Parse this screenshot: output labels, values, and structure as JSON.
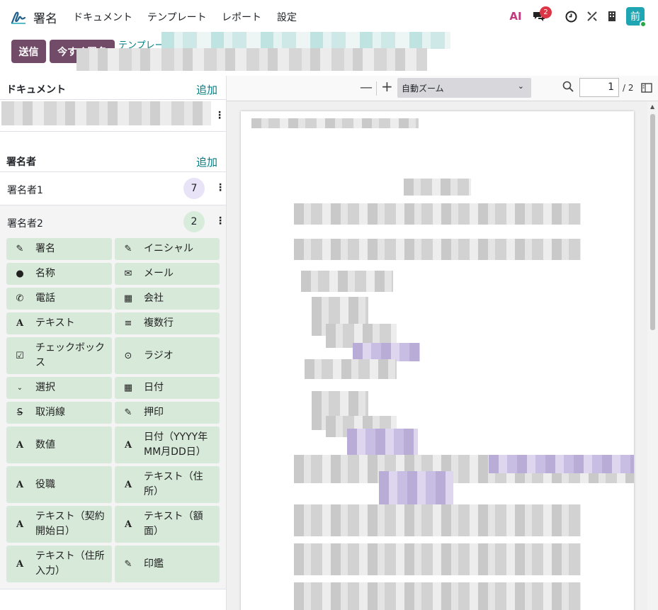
{
  "nav": {
    "app_name": "署名",
    "menus": [
      "ドキュメント",
      "テンプレート",
      "レポート",
      "設定"
    ],
    "ai_label": "AI",
    "chat_badge": "2",
    "avatar": "前"
  },
  "controls": {
    "send": "送信",
    "sign_now": "今すぐ署名",
    "breadcrumb": "テンプレー"
  },
  "documents": {
    "title": "ドキュメント",
    "add": "追加"
  },
  "signers": {
    "title": "署名者",
    "add": "追加",
    "items": [
      {
        "label": "署名者1",
        "count": "7",
        "color": "#e8e3f6"
      },
      {
        "label": "署名者2",
        "count": "2",
        "color": "#d8ecdc"
      }
    ]
  },
  "fields": [
    {
      "label": "署名",
      "icon": "edit-icon"
    },
    {
      "label": "イニシャル",
      "icon": "edit-icon"
    },
    {
      "label": "名称",
      "icon": "user-icon"
    },
    {
      "label": "メール",
      "icon": "envelope-icon"
    },
    {
      "label": "電話",
      "icon": "phone-icon"
    },
    {
      "label": "会社",
      "icon": "building-icon"
    },
    {
      "label": "テキスト",
      "icon": "font-icon"
    },
    {
      "label": "複数行",
      "icon": "lines-icon"
    },
    {
      "label": "チェックボックス",
      "icon": "checkbox-icon"
    },
    {
      "label": "ラジオ",
      "icon": "radio-icon"
    },
    {
      "label": "選択",
      "icon": "chevron-down-icon"
    },
    {
      "label": "日付",
      "icon": "calendar-icon"
    },
    {
      "label": "取消線",
      "icon": "strikethrough-icon"
    },
    {
      "label": "押印",
      "icon": "edit-icon"
    },
    {
      "label": "数値",
      "icon": "font-icon"
    },
    {
      "label": "日付（YYYY年MM月DD日）",
      "icon": "font-icon"
    },
    {
      "label": "役職",
      "icon": "font-icon"
    },
    {
      "label": "テキスト（住所）",
      "icon": "font-icon"
    },
    {
      "label": "テキスト（契約開始日）",
      "icon": "font-icon"
    },
    {
      "label": "テキスト（額面）",
      "icon": "font-icon"
    },
    {
      "label": "テキスト（住所入力）",
      "icon": "font-icon"
    },
    {
      "label": "印鑑",
      "icon": "edit-icon"
    }
  ],
  "viewer": {
    "zoom": "自動ズーム",
    "page": "1",
    "total": "/ 2"
  }
}
